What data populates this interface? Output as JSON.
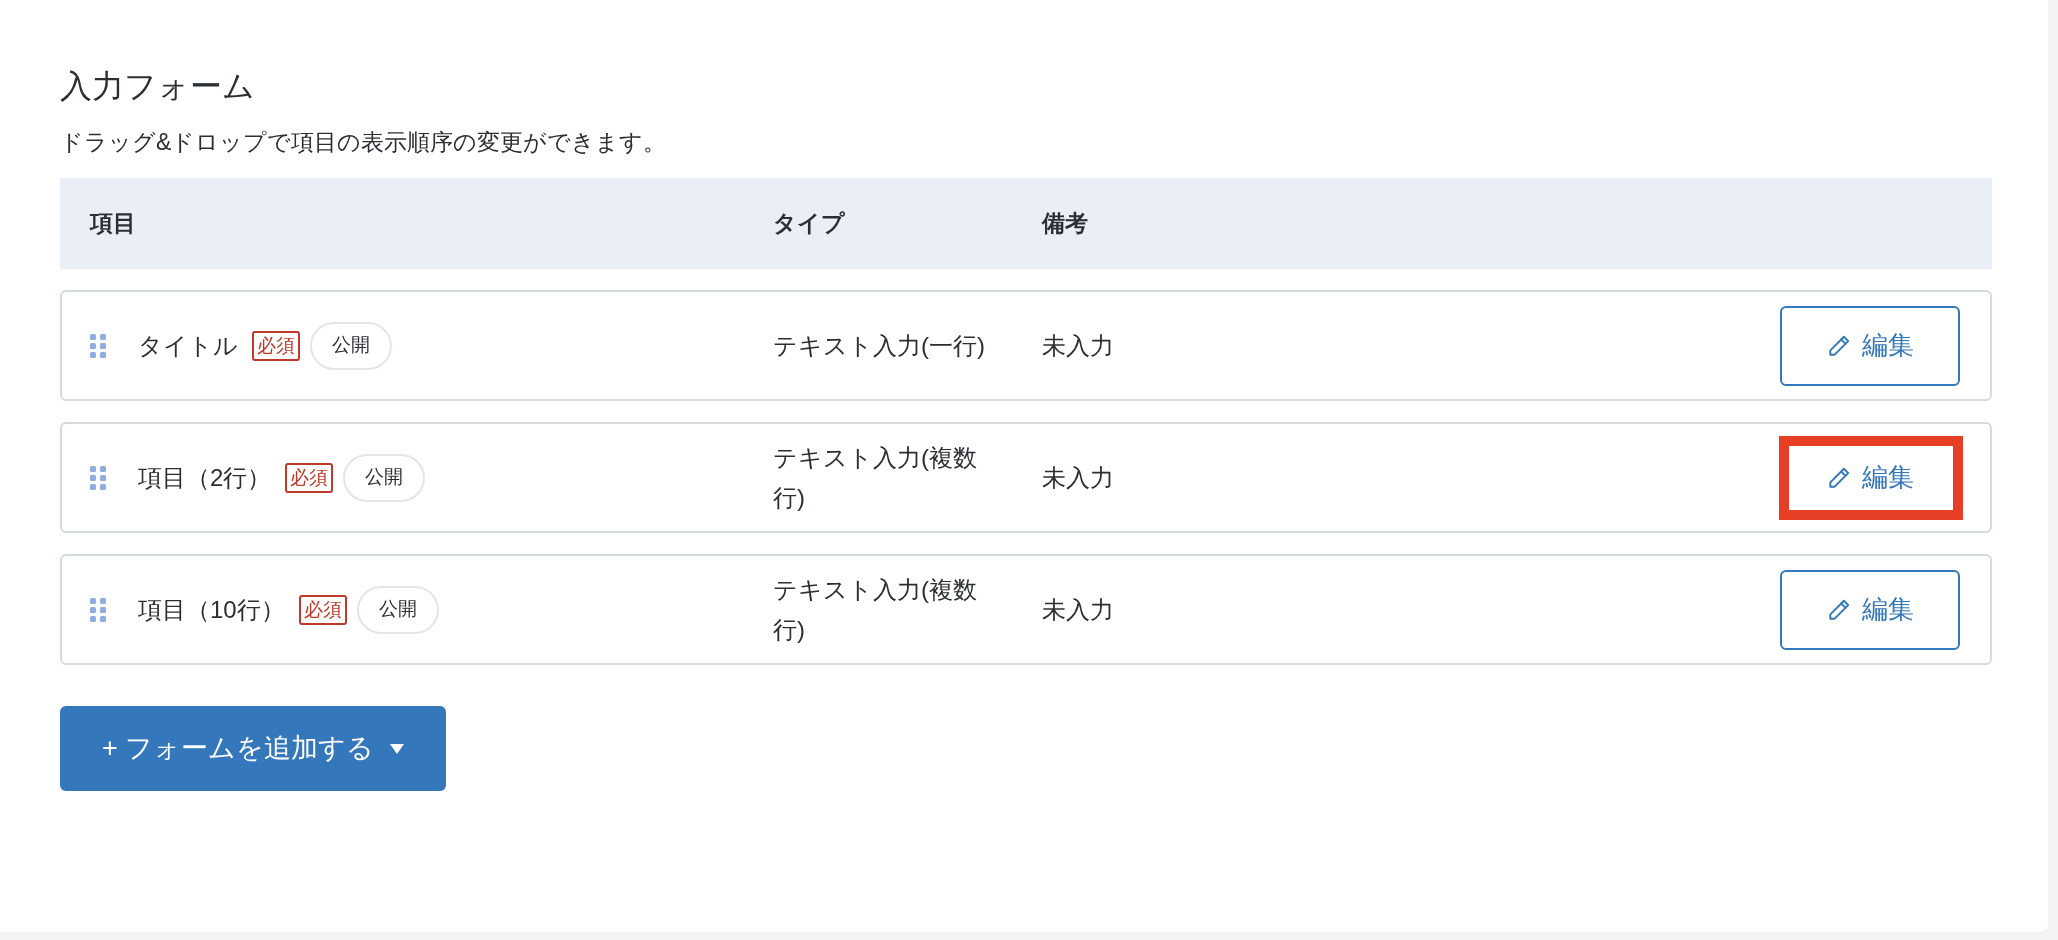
{
  "title": "入力フォーム",
  "description": "ドラッグ&ドロップで項目の表示順序の変更ができます。",
  "table": {
    "columns": [
      "項目",
      "タイプ",
      "備考"
    ],
    "rows": [
      {
        "name": "タイトル",
        "required_badge": "必須",
        "public_badge": "公開",
        "type": "テキスト入力(一行)",
        "note": "未入力",
        "edit_button": "編集",
        "highlighted": false
      },
      {
        "name": "項目（2行）",
        "required_badge": "必須",
        "public_badge": "公開",
        "type": "テキスト入力(複数行)",
        "note": "未入力",
        "edit_button": "編集",
        "highlighted": true
      },
      {
        "name": "項目（10行）",
        "required_badge": "必須",
        "public_badge": "公開",
        "type": "テキスト入力(複数行)",
        "note": "未入力",
        "edit_button": "編集",
        "highlighted": false
      }
    ]
  },
  "add_button": {
    "label": "+ フォームを追加する"
  }
}
